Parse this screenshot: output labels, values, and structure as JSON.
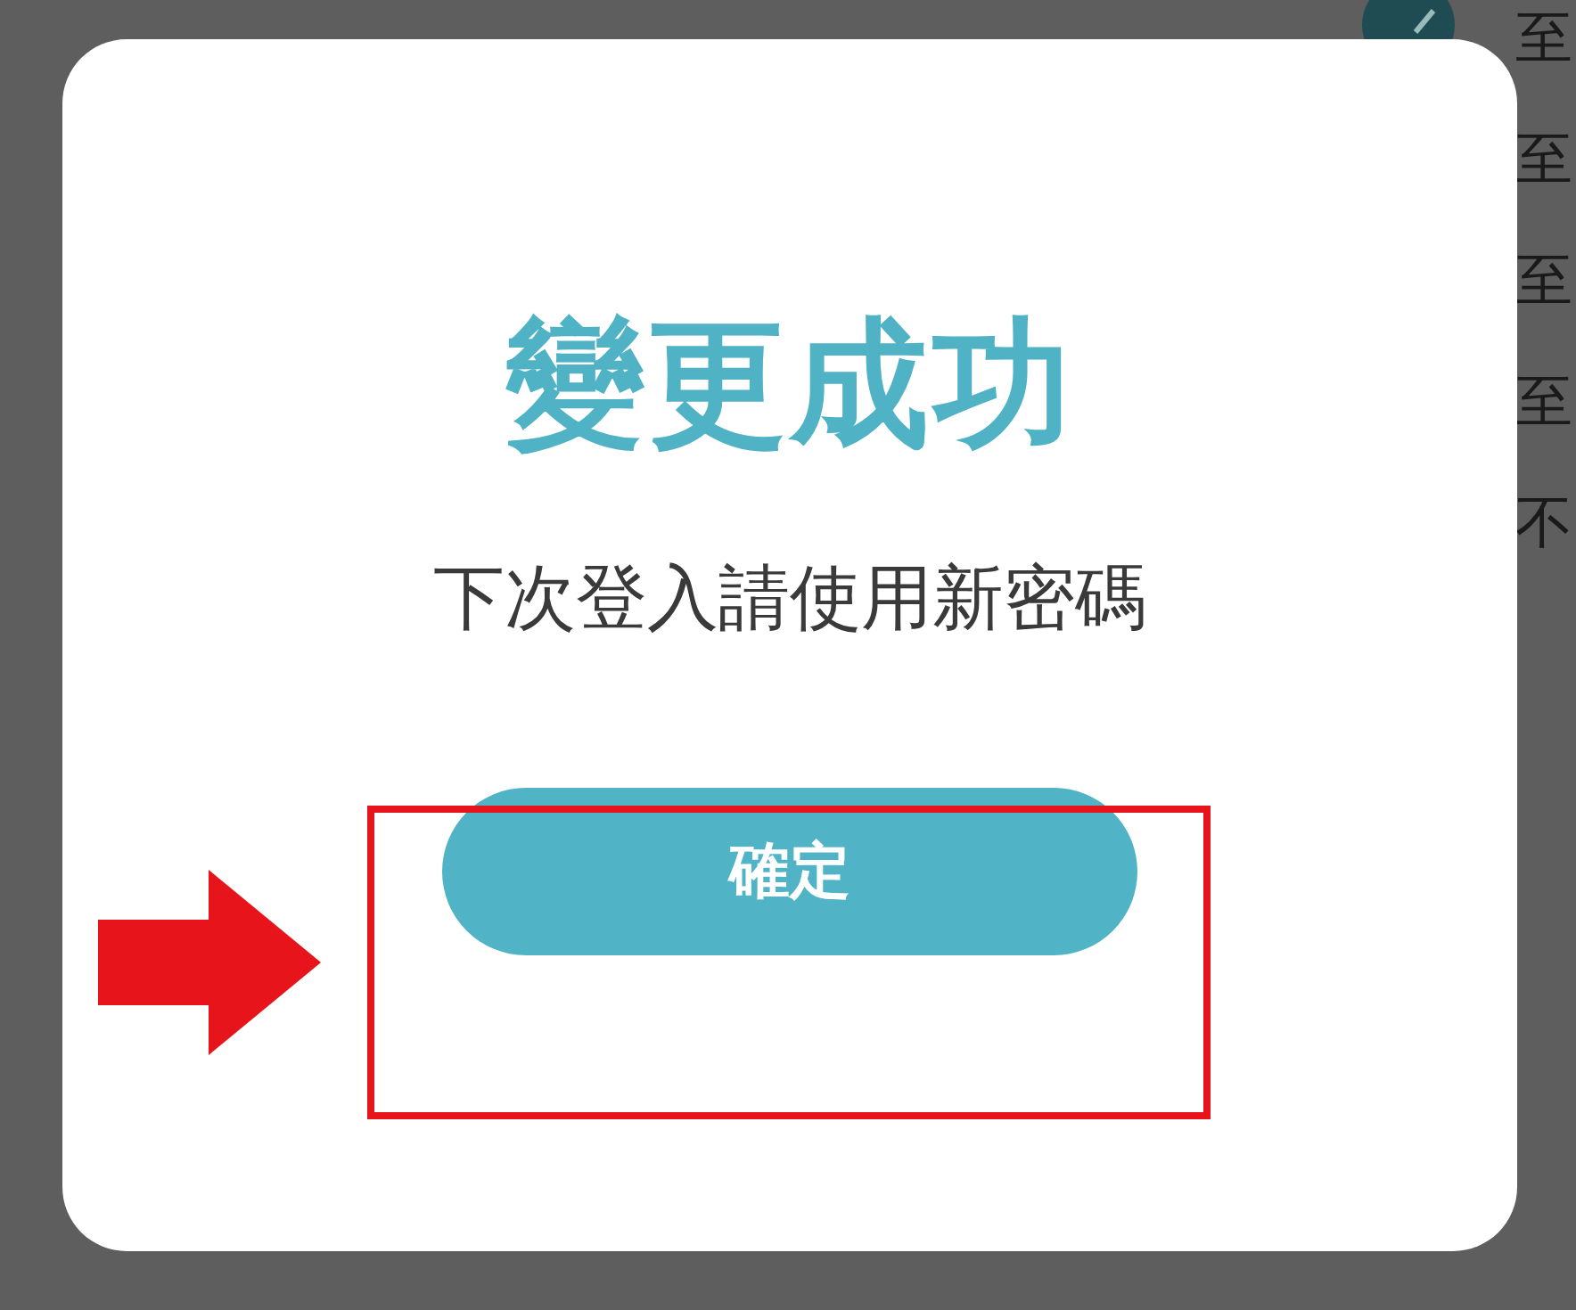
{
  "background": {
    "side_texts": [
      "至",
      "至",
      "至",
      "至",
      "不"
    ]
  },
  "dialog": {
    "title": "變更成功",
    "message": "下次登入請使用新密碼",
    "confirm_button": "確定"
  }
}
